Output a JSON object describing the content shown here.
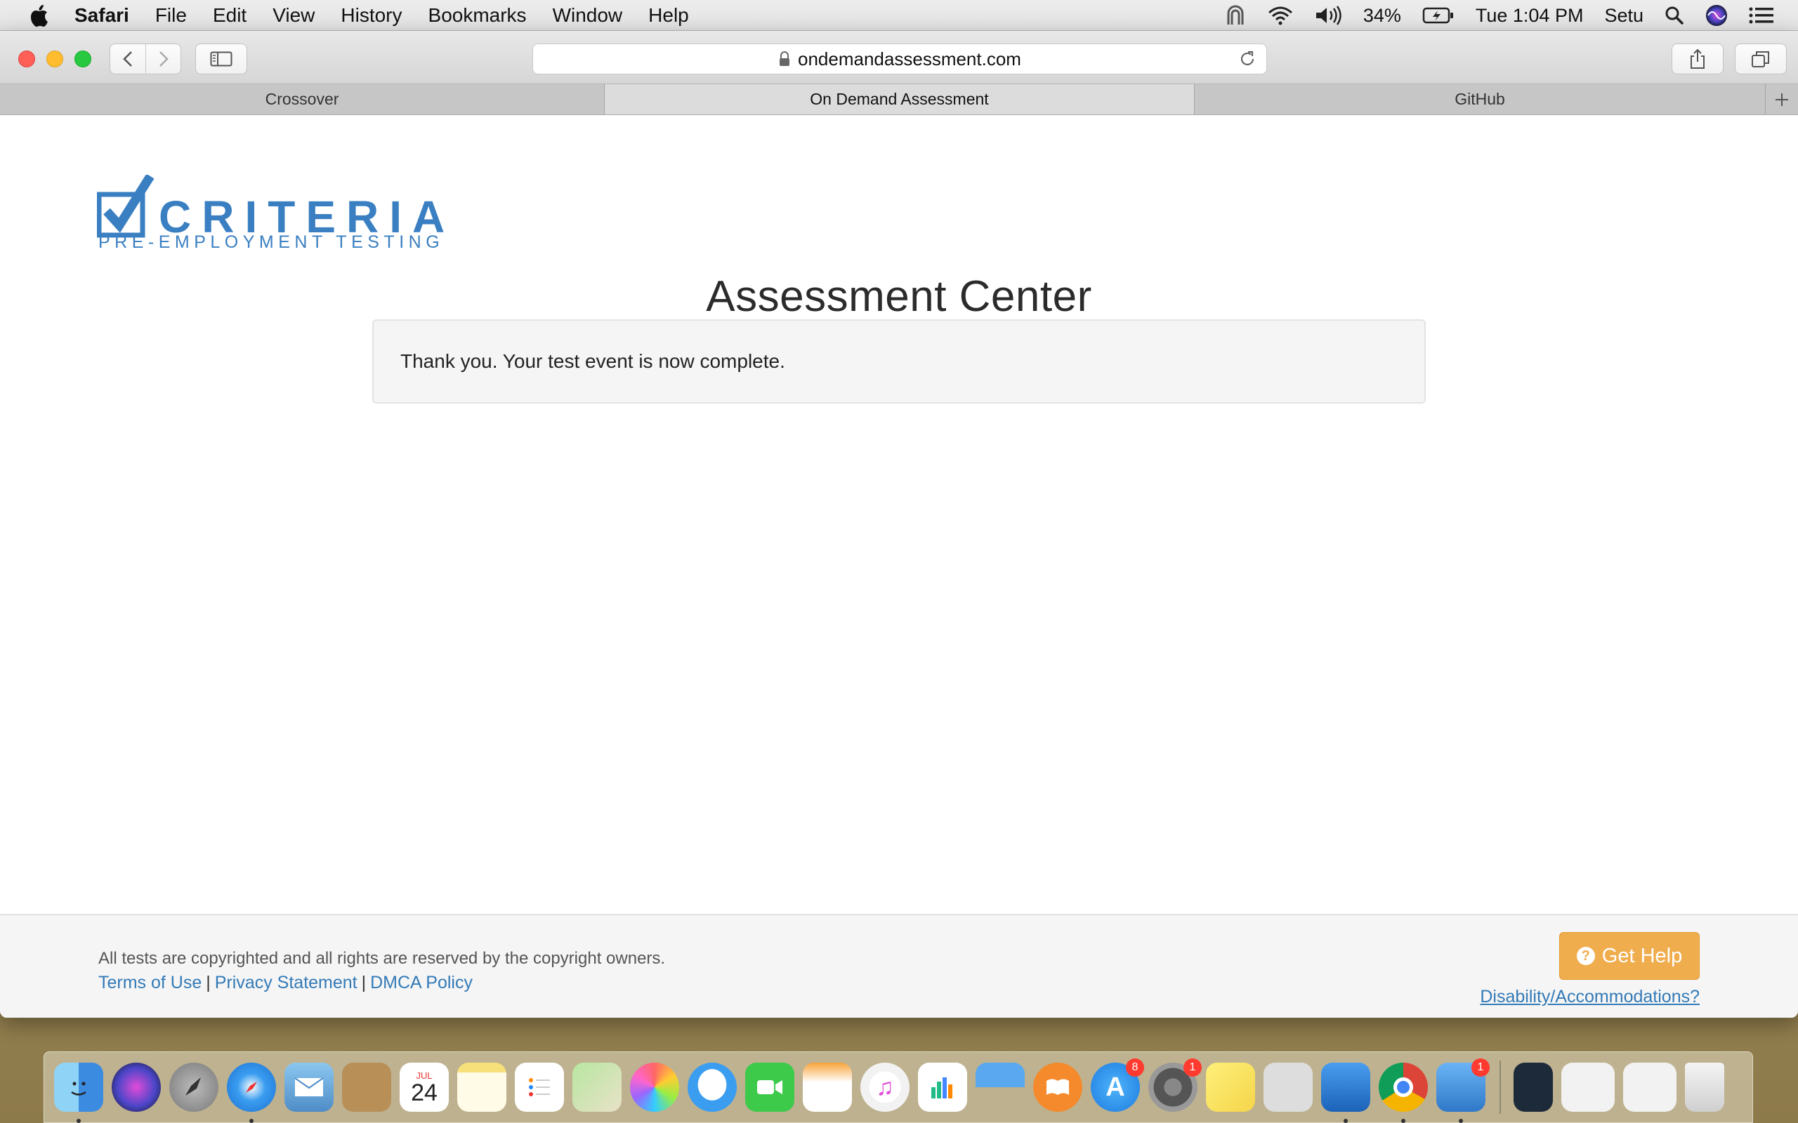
{
  "menubar": {
    "app": "Safari",
    "items": [
      "File",
      "Edit",
      "View",
      "History",
      "Bookmarks",
      "Window",
      "Help"
    ],
    "battery": "34%",
    "clock": "Tue 1:04 PM",
    "user": "Setu",
    "icons": [
      "apple-icon",
      "fan-icon",
      "wifi-icon",
      "volume-icon",
      "battery-icon",
      "spotlight-icon",
      "siri-icon",
      "notification-center-icon"
    ]
  },
  "toolbar": {
    "url": "ondemandassessment.com"
  },
  "tabs": [
    {
      "label": "Crossover"
    },
    {
      "label": "On Demand Assessment",
      "active": true
    },
    {
      "label": "GitHub"
    }
  ],
  "page": {
    "logo": {
      "name": "CRITERIA",
      "tagline": "PRE-EMPLOYMENT TESTING",
      "color": "#3a7fc1"
    },
    "title": "Assessment Center",
    "message": "Thank you. Your test event is now complete.",
    "footer": {
      "copyright": "All tests are copyrighted and all rights are reserved by the copyright owners.",
      "links": [
        "Terms of Use",
        "Privacy Statement",
        "DMCA Policy"
      ],
      "help_button": "Get Help",
      "disability_link": "Disability/Accommodations?"
    }
  },
  "colors": {
    "link": "#337ab7",
    "help_button": "#f0ad4e",
    "brand": "#3a7fc1"
  },
  "dock": {
    "apps": [
      {
        "name": "finder-icon",
        "running": true
      },
      {
        "name": "siri-icon"
      },
      {
        "name": "launchpad-icon"
      },
      {
        "name": "safari-icon",
        "running": true
      },
      {
        "name": "mail-icon"
      },
      {
        "name": "contacts-icon"
      },
      {
        "name": "calendar-icon",
        "month": "JUL",
        "day": "24"
      },
      {
        "name": "notes-icon"
      },
      {
        "name": "reminders-icon"
      },
      {
        "name": "maps-icon"
      },
      {
        "name": "photos-icon"
      },
      {
        "name": "messages-icon"
      },
      {
        "name": "facetime-icon"
      },
      {
        "name": "pages-icon"
      },
      {
        "name": "itunes-icon"
      },
      {
        "name": "numbers-icon"
      },
      {
        "name": "keynote-icon"
      },
      {
        "name": "ibooks-icon"
      },
      {
        "name": "app-store-icon",
        "badge": "8"
      },
      {
        "name": "system-preferences-icon",
        "badge": "1"
      },
      {
        "name": "stickies-icon"
      },
      {
        "name": "screenshot-utility-icon"
      },
      {
        "name": "xcode-icon",
        "running": true
      },
      {
        "name": "chrome-icon",
        "running": true
      },
      {
        "name": "stack-app-icon",
        "badge": "1",
        "running": true
      }
    ],
    "right": [
      {
        "name": "activity-window-icon"
      },
      {
        "name": "chrome-window-icon"
      },
      {
        "name": "finder-window-icon"
      },
      {
        "name": "trash-icon"
      }
    ]
  }
}
